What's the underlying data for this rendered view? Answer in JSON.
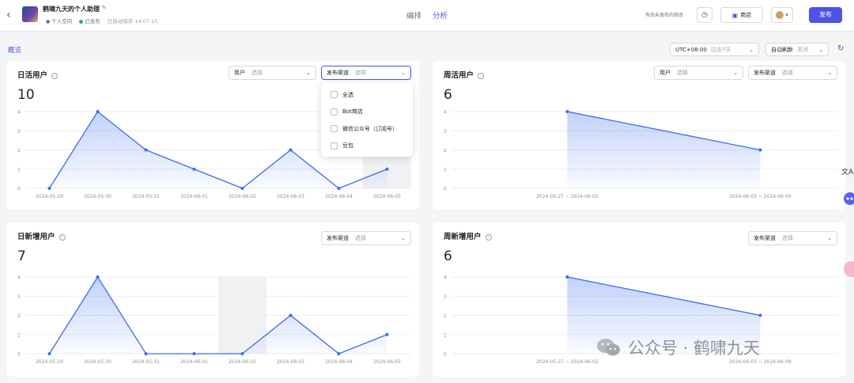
{
  "header": {
    "back_icon": "chevron-left-icon",
    "bot_name": "鹤啸九天的个人助理",
    "space": "个人空间",
    "status": "已发布",
    "saved": "已自动保存 14:07:15",
    "tabs": [
      {
        "label": "编排",
        "active": false
      },
      {
        "label": "分析",
        "active": true
      }
    ],
    "unpublished_note": "有尚未发布的修改",
    "store_label": "商店",
    "publish_label": "发布",
    "accent": "#4d53e8"
  },
  "toolbar": {
    "overview_label": "概览",
    "timezone": "UTC+08:00",
    "range_placeholder": "过去7天",
    "auto_refresh": "自动刷新",
    "auto_refresh_value": "关闭"
  },
  "filters": {
    "user_label": "用户",
    "channel_label": "发布渠道",
    "placeholder": "选择"
  },
  "dropdown": {
    "options": [
      "全选",
      "Bot商店",
      "微信公众号（订阅号）",
      "豆包"
    ]
  },
  "cards": {
    "dau": {
      "title": "日活用户",
      "total": "10"
    },
    "wau": {
      "title": "周活用户",
      "total": "6"
    },
    "dnu": {
      "title": "日新增用户",
      "total": "7"
    },
    "wnu": {
      "title": "周新增用户",
      "total": "6"
    }
  },
  "watermark": "公众号 · 鹤啸九天",
  "chart_data": [
    {
      "type": "area",
      "title": "日活用户",
      "x": [
        "2024-05-29",
        "2024-05-30",
        "2024-05-31",
        "2024-06-01",
        "2024-06-02",
        "2024-06-03",
        "2024-06-04",
        "2024-06-05"
      ],
      "series": [
        {
          "values": [
            0,
            4,
            2,
            1,
            0,
            2,
            0,
            1
          ]
        }
      ],
      "ylim": [
        0,
        4
      ],
      "yticks": [
        0,
        1,
        2,
        3,
        4
      ],
      "highlight_index": 7
    },
    {
      "type": "area",
      "title": "周活用户",
      "x": [
        "2024-05-27 ~ 2024-06-02",
        "2024-06-03 ~ 2024-06-09"
      ],
      "series": [
        {
          "values": [
            4,
            2
          ]
        }
      ],
      "ylim": [
        0,
        4
      ],
      "yticks": [
        0,
        1,
        2,
        3,
        4
      ]
    },
    {
      "type": "area",
      "title": "日新增用户",
      "x": [
        "2024-05-29",
        "2024-05-30",
        "2024-05-31",
        "2024-06-01",
        "2024-06-02",
        "2024-06-03",
        "2024-06-04",
        "2024-06-05"
      ],
      "series": [
        {
          "values": [
            0,
            4,
            0,
            0,
            0,
            2,
            0,
            1
          ]
        }
      ],
      "ylim": [
        0,
        4
      ],
      "yticks": [
        0,
        1,
        2,
        3,
        4
      ],
      "highlight_index": 4
    },
    {
      "type": "area",
      "title": "周新增用户",
      "x": [
        "2024-05-27 ~ 2024-06-02",
        "2024-06-03 ~ 2024-06-09"
      ],
      "series": [
        {
          "values": [
            4,
            2
          ]
        }
      ],
      "ylim": [
        0,
        4
      ],
      "yticks": [
        0,
        1,
        2,
        3,
        4
      ]
    }
  ]
}
